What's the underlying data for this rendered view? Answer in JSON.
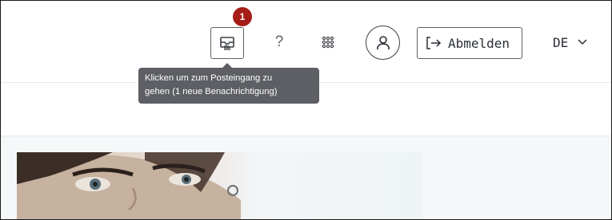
{
  "header": {
    "notification_count": "1",
    "help_label": "?",
    "logout_label": "Abmelden",
    "language": "DE"
  },
  "tooltip": {
    "line1": "Klicken um zum Posteingang zu",
    "line2": "gehen (1 neue Benachrichtigung)"
  },
  "icons": {
    "inbox": "inbox-icon",
    "apps": "apps-grid-icon",
    "user": "user-icon",
    "logout": "logout-icon",
    "chevron": "chevron-down-icon"
  },
  "colors": {
    "badge": "#a61c16",
    "tooltip_bg": "#5d5f64",
    "border": "#5b5f66"
  }
}
